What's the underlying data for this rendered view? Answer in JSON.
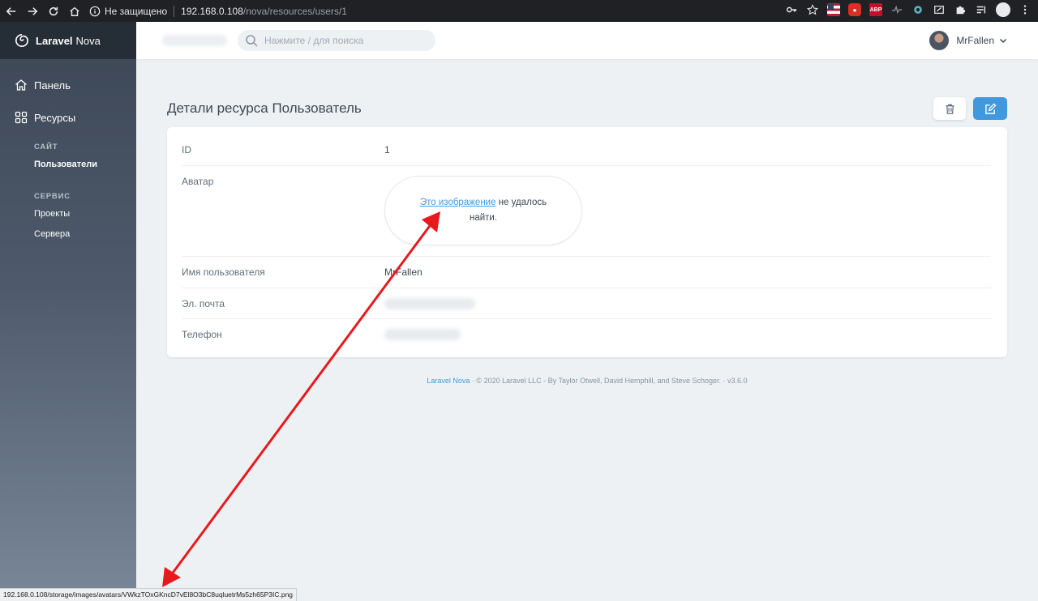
{
  "browser": {
    "security_label": "Не защищено",
    "url_host": "192.168.0.108",
    "url_path": "/nova/resources/users/1",
    "status_url": "192.168.0.108/storage/images/avatars/VWkzTOxGKncD7vEl8O3bC8uqluetrMs5zh65P3IC.png",
    "extensions": [
      "key-icon",
      "star-icon",
      "flag-us-icon",
      "red-extension-icon",
      "adblock-icon",
      "pulse-icon",
      "gear-extension-icon",
      "screenshot-icon",
      "puzzle-icon",
      "reading-list-icon",
      "profile-icon",
      "more-vert-icon"
    ]
  },
  "sidebar": {
    "brand_bold": "Laravel",
    "brand_light": "Nova",
    "dashboard": "Панель",
    "resources": "Ресурсы",
    "groups": [
      {
        "title": "САЙТ",
        "items": [
          "Пользователи"
        ]
      },
      {
        "title": "СЕРВИС",
        "items": [
          "Проекты",
          "Сервера"
        ]
      }
    ]
  },
  "topbar": {
    "search_placeholder": "Нажмите / для поиска",
    "user_name": "MrFallen"
  },
  "main": {
    "title": "Детали ресурса Пользователь",
    "fields": {
      "id_label": "ID",
      "id_value": "1",
      "avatar_label": "Аватар",
      "avatar_link": "Это изображение",
      "avatar_rest": " не удалось найти.",
      "username_label": "Имя пользователя",
      "username_value": "MrFallen",
      "email_label": "Эл. почта",
      "phone_label": "Телефон"
    }
  },
  "footer": {
    "link": "Laravel Nova",
    "text": " · © 2020 Laravel LLC - By Taylor Otwell, David Hemphill, and Steve Schoger. · v3.6.0"
  },
  "colors": {
    "accent": "#4099de",
    "annotation_arrow": "#e8191c",
    "sidebar_top": "#3c4655",
    "sidebar_bottom": "#7a8798",
    "page_bg": "#eef1f4"
  }
}
